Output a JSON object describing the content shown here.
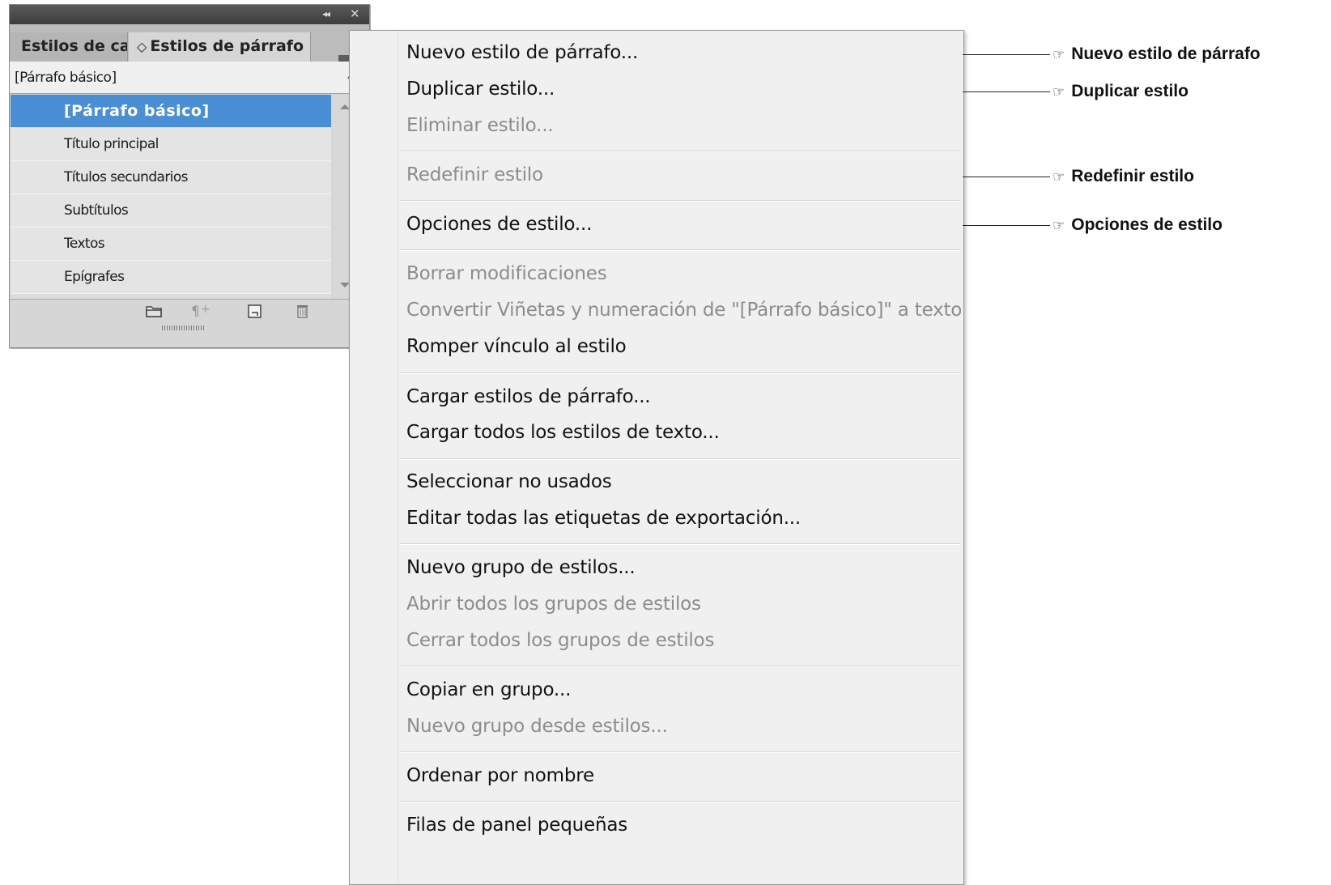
{
  "panel": {
    "collapse_glyph": "◂◂",
    "close_glyph": "✕",
    "tabs": [
      {
        "label": "Estilos de carácter"
      },
      {
        "label": "Estilos de párrafo",
        "arrow": "◇"
      }
    ],
    "menu_glyph": "▾≡",
    "current_style": "[Párrafo básico]",
    "styles": [
      {
        "label": "[Párrafo básico]",
        "selected": true
      },
      {
        "label": "Título principal"
      },
      {
        "label": "Títulos secundarios"
      },
      {
        "label": "Subtítulos"
      },
      {
        "label": "Textos"
      },
      {
        "label": "Epígrafes"
      }
    ],
    "footer_icons": [
      "folder-icon",
      "clear-overrides-icon",
      "new-style-icon",
      "trash-icon"
    ]
  },
  "menu": {
    "items": [
      {
        "label": "Nuevo estilo de párrafo...",
        "enabled": true
      },
      {
        "label": "Duplicar estilo...",
        "enabled": true
      },
      {
        "label": "Eliminar estilo...",
        "enabled": false
      },
      {
        "label": "Redefinir estilo",
        "enabled": false
      },
      {
        "label": "Opciones de estilo...",
        "enabled": true
      },
      {
        "label": "Borrar modificaciones",
        "enabled": false
      },
      {
        "label": "Convertir Viñetas y numeración de \"[Párrafo básico]\" a texto",
        "enabled": false
      },
      {
        "label": "Romper vínculo al estilo",
        "enabled": true
      },
      {
        "label": "Cargar estilos de párrafo...",
        "enabled": true
      },
      {
        "label": "Cargar todos los estilos de texto...",
        "enabled": true
      },
      {
        "label": "Seleccionar no usados",
        "enabled": true
      },
      {
        "label": "Editar todas las etiquetas de exportación...",
        "enabled": true
      },
      {
        "label": "Nuevo grupo de estilos...",
        "enabled": true
      },
      {
        "label": "Abrir todos los grupos de estilos",
        "enabled": false
      },
      {
        "label": "Cerrar todos los grupos de estilos",
        "enabled": false
      },
      {
        "label": "Copiar en grupo...",
        "enabled": true
      },
      {
        "label": "Nuevo grupo desde estilos...",
        "enabled": false
      },
      {
        "label": "Ordenar por nombre",
        "enabled": true
      },
      {
        "label": "Filas de panel pequeñas",
        "enabled": true
      }
    ]
  },
  "callouts": {
    "hand_glyph": "☞",
    "items": [
      {
        "label": "Nuevo estilo de párrafo"
      },
      {
        "label": "Duplicar estilo"
      },
      {
        "label": "Redefinir estilo"
      },
      {
        "label": "Opciones de estilo"
      }
    ]
  },
  "colors": {
    "selected_row": "#4a8fd3",
    "titlebar": "#474747",
    "menu_bg": "#f0f0f0",
    "disabled_text": "#8c8c8c"
  }
}
